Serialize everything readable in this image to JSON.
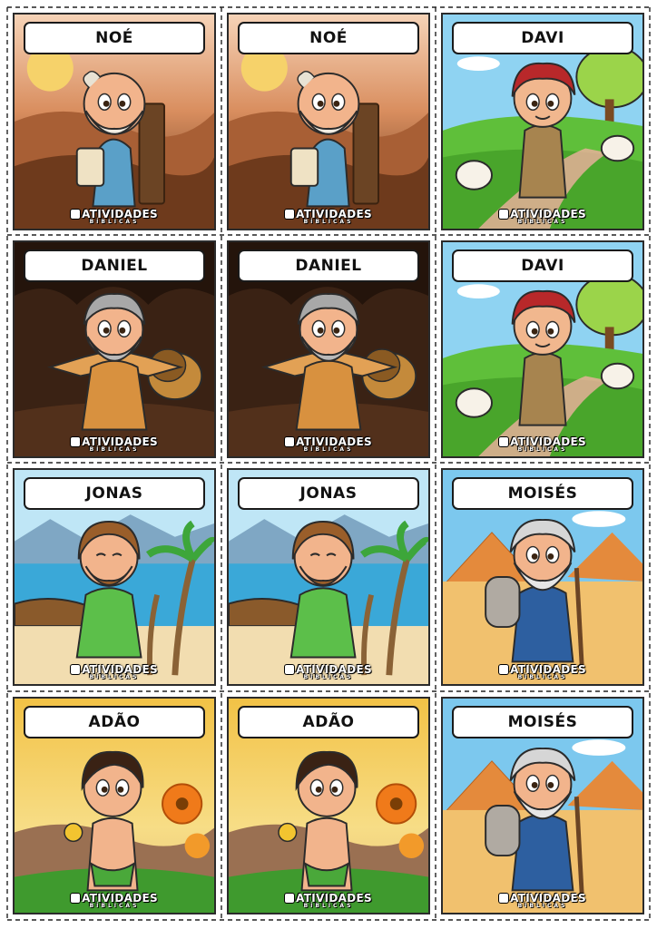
{
  "brand": {
    "name": "ATIVIDADES",
    "subtitle": "BÍBLICAS"
  },
  "cards": [
    {
      "name": "NOÉ",
      "scene": "noe"
    },
    {
      "name": "NOÉ",
      "scene": "noe"
    },
    {
      "name": "DAVI",
      "scene": "davi"
    },
    {
      "name": "DANIEL",
      "scene": "daniel"
    },
    {
      "name": "DANIEL",
      "scene": "daniel"
    },
    {
      "name": "DAVI",
      "scene": "davi"
    },
    {
      "name": "JONAS",
      "scene": "jonas"
    },
    {
      "name": "JONAS",
      "scene": "jonas"
    },
    {
      "name": "MOISÉS",
      "scene": "moises"
    },
    {
      "name": "ADÃO",
      "scene": "adao"
    },
    {
      "name": "ADÃO",
      "scene": "adao"
    },
    {
      "name": "MOISÉS",
      "scene": "moises"
    }
  ],
  "icons": {
    "brand_logo": "bible-book-icon",
    "cut_marks": "scissors-cut-line"
  }
}
